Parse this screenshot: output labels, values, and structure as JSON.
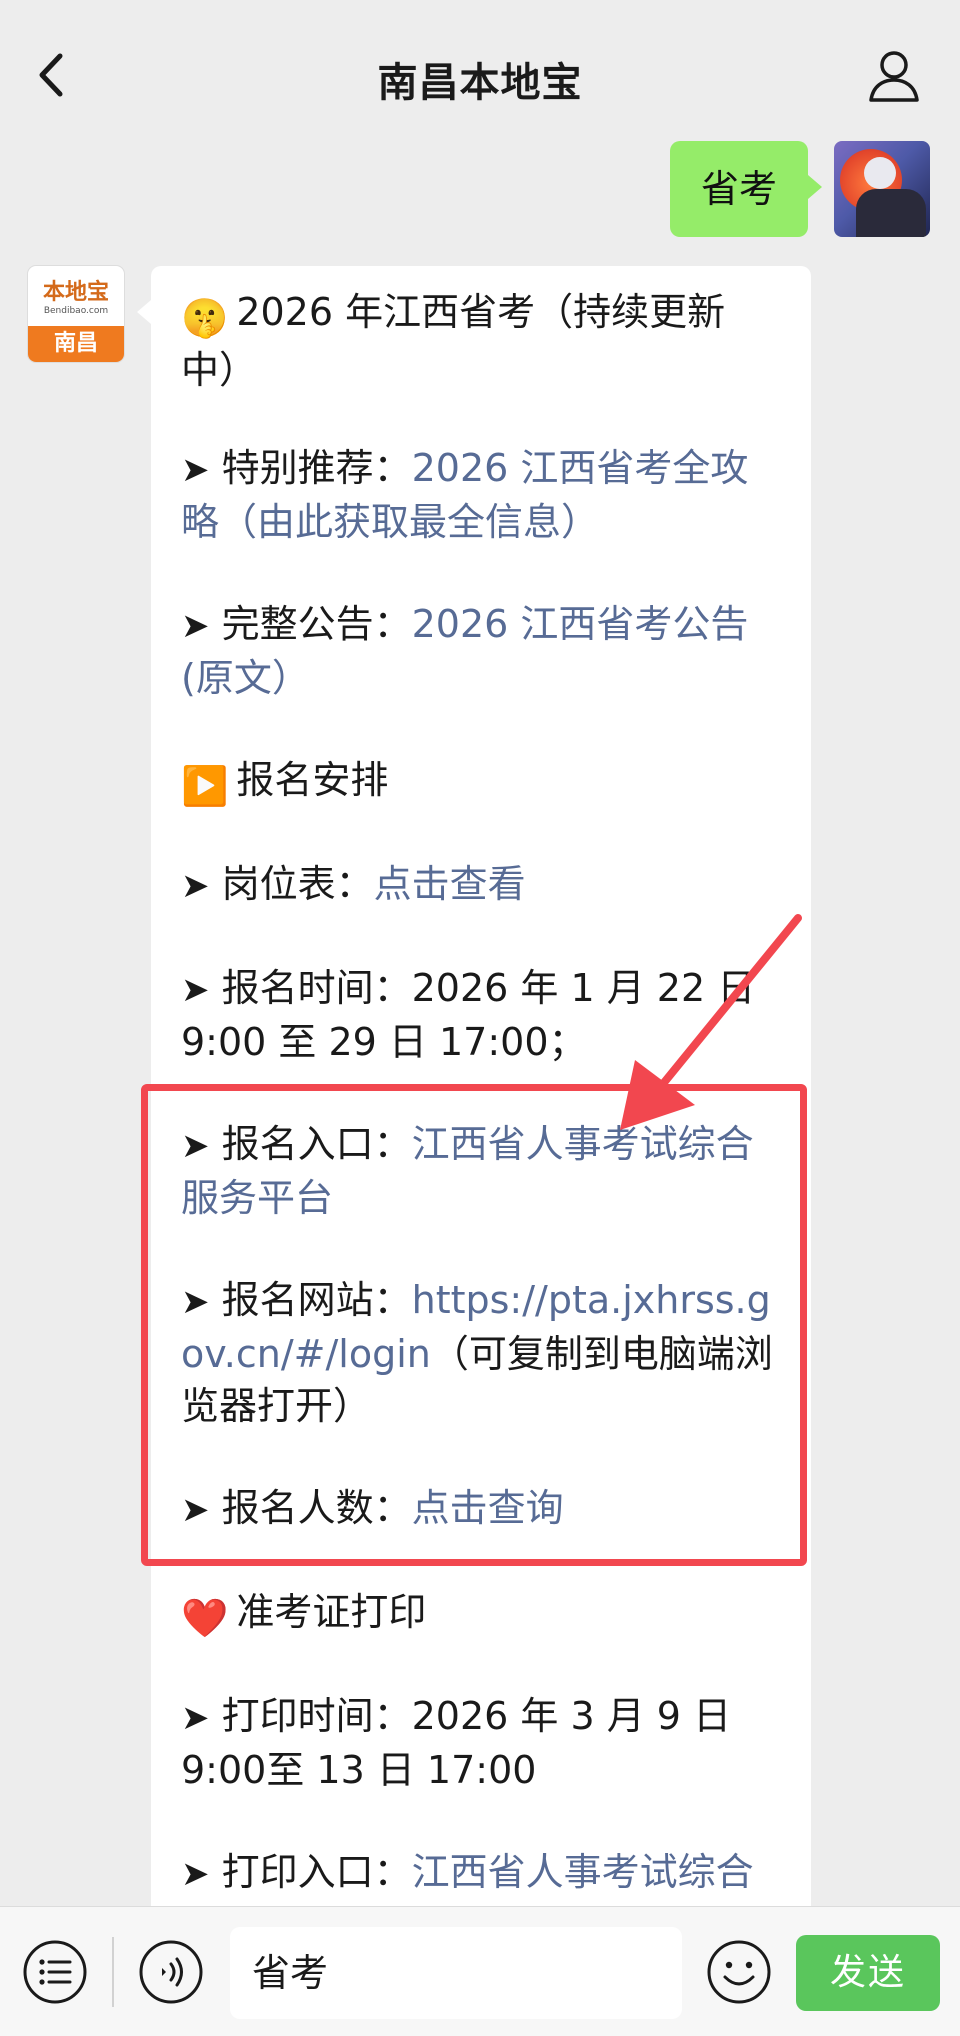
{
  "header": {
    "title": "南昌本地宝",
    "back_icon": "chevron-left-icon",
    "user_icon": "person-outline-icon"
  },
  "sent_message": {
    "text": "省考"
  },
  "bot": {
    "logo_text": "本地宝",
    "logo_domain": "Bendibao.com",
    "logo_city": "南昌"
  },
  "message": {
    "title": {
      "emoji": "🤫",
      "text": "2026 年江西省考（持续更新中）"
    },
    "recommend": {
      "arrow": "➤",
      "label": "特别推荐：",
      "link": "2026 江西省考全攻略（由此获取最全信息）"
    },
    "announcement": {
      "arrow": "➤",
      "label": "完整公告：",
      "link": "2026 江西省考公告(原文）"
    },
    "reg_section": {
      "emoji": "▶️",
      "text": "报名安排"
    },
    "positions": {
      "arrow": "➤",
      "label": "岗位表：",
      "link": "点击查看"
    },
    "reg_time": {
      "arrow": "➤",
      "label": "报名时间：",
      "value": "2026 年 1 月 22 日 9:00 至 29 日 17:00；"
    },
    "reg_entry": {
      "arrow": "➤",
      "label": "报名入口：",
      "link": "江西省人事考试综合服务平台"
    },
    "reg_site": {
      "arrow": "➤",
      "label": "报名网站：",
      "link": "https://pta.jxhrss.gov.cn/#/login",
      "note": "（可复制到电脑端浏览器打开）"
    },
    "reg_count": {
      "arrow": "➤",
      "label": "报名人数：",
      "link": "点击查询"
    },
    "admit_section": {
      "emoji": "❤️",
      "text": "准考证打印"
    },
    "print_time": {
      "arrow": "➤",
      "label": "打印时间：",
      "value": "2026 年 3 月 9 日 9:00至 13 日 17:00"
    },
    "print_entry": {
      "arrow": "➤",
      "label": "打印入口：",
      "link": "江西省人事考试综合"
    }
  },
  "input_bar": {
    "menu_icon": "list-menu-icon",
    "voice_icon": "voice-icon",
    "input_value": "省考",
    "emoji_icon": "smile-icon",
    "send_label": "发送"
  },
  "colors": {
    "background": "#ededed",
    "sent_bubble": "#95ec69",
    "link": "#576b95",
    "highlight": "#f2474f",
    "send_button": "#5ac65c"
  }
}
